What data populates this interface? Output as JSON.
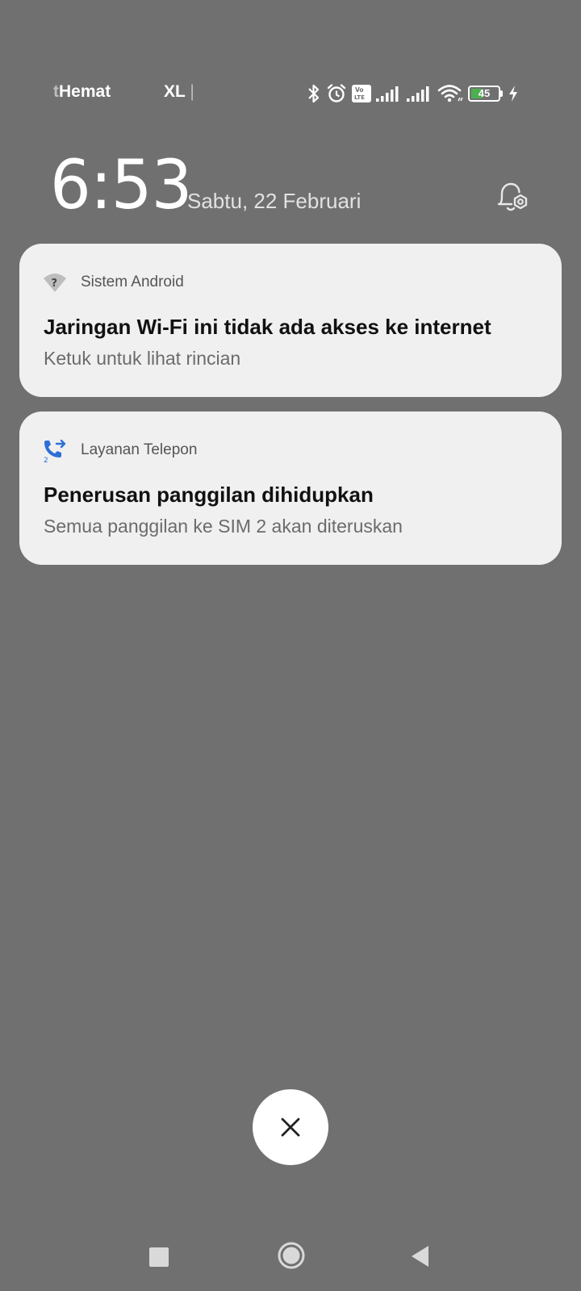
{
  "status_bar": {
    "carrier1_prefix": "t",
    "carrier1_rest": "Hemat",
    "carrier2": "XL",
    "carrier2_sep": "|",
    "battery_level": "45",
    "battery_fraction": 0.45,
    "icons": [
      "bluetooth-icon",
      "alarm-icon",
      "volte-icon",
      "signal-sim1-icon",
      "signal-sim2-icon",
      "wifi-icon",
      "battery-icon",
      "charging-icon"
    ]
  },
  "lockscreen": {
    "time": "6:53",
    "date": "Sabtu, 22 Februari"
  },
  "notifications": [
    {
      "app": "Sistem Android",
      "icon": "wifi-question-icon",
      "title": "Jaringan Wi-Fi ini tidak ada akses ke internet",
      "text": "Ketuk untuk lihat rincian"
    },
    {
      "app": "Layanan Telepon",
      "icon": "call-forward-icon",
      "title": "Penerusan panggilan dihidupkan",
      "text": "Semua panggilan ke SIM 2 akan diteruskan"
    }
  ],
  "colors": {
    "background": "#707070",
    "card": "#f0f0f0",
    "battery": "#4caf50",
    "phone_icon": "#2f6fd6"
  }
}
